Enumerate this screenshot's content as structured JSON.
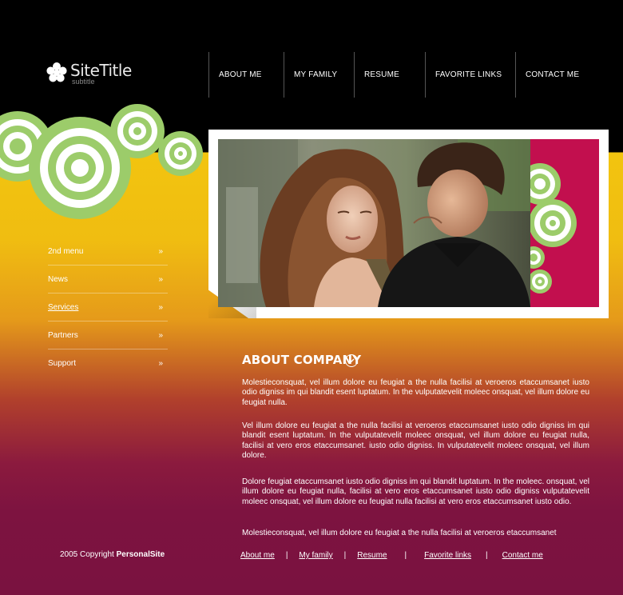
{
  "brand": {
    "title": "SiteTitle",
    "subtitle": "subtitle"
  },
  "topnav": [
    {
      "label": "ABOUT ME"
    },
    {
      "label": "MY FAMILY"
    },
    {
      "label": "RESUME"
    },
    {
      "label": "FAVORITE LINKS"
    },
    {
      "label": "CONTACT ME"
    }
  ],
  "leftmenu": [
    {
      "label": "2nd menu",
      "arrow": "»"
    },
    {
      "label": "News",
      "arrow": "»"
    },
    {
      "label": "Services",
      "arrow": "»"
    },
    {
      "label": "Partners",
      "arrow": "»"
    },
    {
      "label": "Support",
      "arrow": "»"
    }
  ],
  "about": {
    "title": "ABOUT COMPANY",
    "paragraphs": [
      "Molestieconsquat, vel illum dolore eu feugiat a the nulla facilisi at veroeros etaccumsanet iusto odio digniss im qui blandit esent luptatum. In the vulputatevelit moleec onsquat, vel illum dolore eu feugiat nulla.",
      "Vel illum dolore eu feugiat a the nulla facilisi at veroeros etaccumsanet iusto odio digniss im qui blandit esent luptatum. In the vulputatevelit moleec onsquat, vel illum dolore eu feugiat nulla, facilisi at vero eros etaccumsanet. iusto odio digniss. In vulputatevelit moleec onsquat, vel illum dolore.",
      "Dolore feugiat   etaccumsanet iusto odio digniss im qui blandit luptatum. In the moleec. onsquat, vel illum dolore eu feugiat nulla, facilisi at vero eros etaccumsanet iusto odio digniss vulputatevelit moleec onsquat, vel illum dolore eu feugiat nulla facilisi at vero eros etaccumsanet iusto odio.",
      "Molestieconsquat, vel illum dolore eu feugiat a the nulla facilisi at veroeros etaccumsanet"
    ]
  },
  "footer": {
    "copyright_prefix": "2005 Copyright ",
    "copyright_name": "PersonalSite",
    "links": [
      {
        "label": "About me"
      },
      {
        "label": "My family"
      },
      {
        "label": "Resume"
      },
      {
        "label": "Favorite links"
      },
      {
        "label": "Contact me"
      }
    ],
    "separator": "|"
  },
  "colors": {
    "accent_green": "#9ccc6a",
    "photo_side": "#c20f4e",
    "yellow": "#f2c40f",
    "maroon": "#7a1240"
  },
  "icons": {
    "logo": "flower-icon",
    "about": "chevron-down-circle-icon",
    "menu_arrow": "double-chevron-right"
  }
}
